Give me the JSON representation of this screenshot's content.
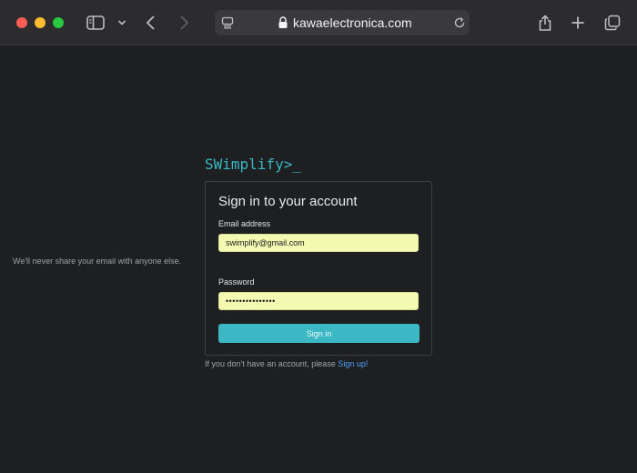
{
  "browser": {
    "url": "kawaelectronica.com",
    "icons": [
      "sidebar-icon",
      "chevron-down-icon",
      "back-icon",
      "forward-icon",
      "reader-icon",
      "lock-icon",
      "reload-icon",
      "share-icon",
      "new-tab-icon",
      "tabs-icon"
    ]
  },
  "brand": {
    "logo": "SWimplify>_"
  },
  "form": {
    "title": "Sign in to your account",
    "email_label": "Email address",
    "email_value": "swimplify@gmail.com",
    "email_hint": "We'll never share your email with anyone else.",
    "password_label": "Password",
    "password_value": "•••••••••••••••",
    "submit_label": "Sign in"
  },
  "footer": {
    "prompt": "If you don't have an account, please ",
    "link_label": "Sign up!"
  },
  "colors": {
    "accent": "#3bb8c4",
    "link": "#4ea1ff",
    "field_background": "#f4f9b1",
    "page_background": "#1e1f20"
  }
}
